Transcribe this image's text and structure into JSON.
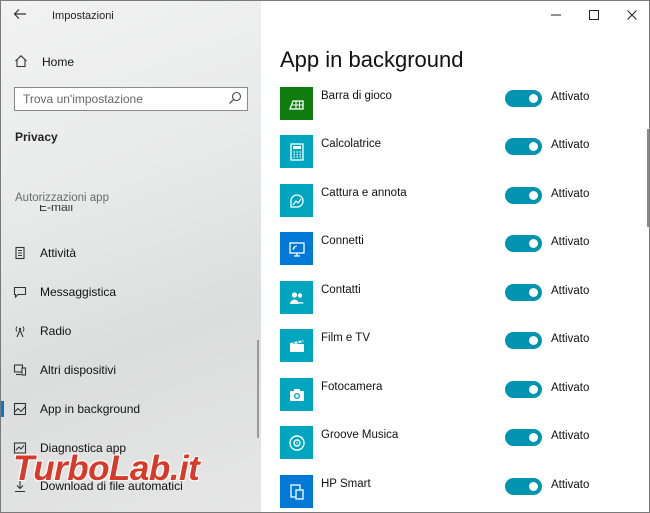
{
  "window": {
    "title": "Impostazioni"
  },
  "sidebar": {
    "home_label": "Home",
    "search_placeholder": "Trova un'impostazione",
    "section_title": "Privacy",
    "group_label": "Autorizzazioni app",
    "partial_item": "E-mail",
    "items": [
      {
        "label": "Attività",
        "icon": "activity-icon"
      },
      {
        "label": "Messaggistica",
        "icon": "message-icon"
      },
      {
        "label": "Radio",
        "icon": "radio-icon"
      },
      {
        "label": "Altri dispositivi",
        "icon": "devices-icon"
      },
      {
        "label": "App in background",
        "icon": "background-apps-icon",
        "active": true
      },
      {
        "label": "Diagnostica app",
        "icon": "diagnostics-icon"
      },
      {
        "label": "Download di file automatici",
        "icon": "download-icon"
      }
    ]
  },
  "main": {
    "title": "App in background",
    "apps": [
      {
        "name": "Barra di gioco",
        "state": "Attivato",
        "tile_color": "#107c10",
        "icon": "game-bar-icon"
      },
      {
        "name": "Calcolatrice",
        "state": "Attivato",
        "tile_color": "#00a5bf",
        "icon": "calculator-icon"
      },
      {
        "name": "Cattura e annota",
        "state": "Attivato",
        "tile_color": "#00a5bf",
        "icon": "snip-icon"
      },
      {
        "name": "Connetti",
        "state": "Attivato",
        "tile_color": "#0078d7",
        "icon": "connect-icon"
      },
      {
        "name": "Contatti",
        "state": "Attivato",
        "tile_color": "#00a5bf",
        "icon": "contacts-icon"
      },
      {
        "name": "Film e TV",
        "state": "Attivato",
        "tile_color": "#00a5bf",
        "icon": "movies-icon"
      },
      {
        "name": "Fotocamera",
        "state": "Attivato",
        "tile_color": "#00a5bf",
        "icon": "camera-icon"
      },
      {
        "name": "Groove Musica",
        "state": "Attivato",
        "tile_color": "#00a5bf",
        "icon": "groove-icon"
      },
      {
        "name": "HP Smart",
        "state": "Attivato",
        "tile_color": "#0078d7",
        "icon": "hp-smart-icon"
      }
    ]
  },
  "watermark": {
    "text": "TurboLab.it"
  },
  "colors": {
    "accent": "#0078d7",
    "toggle_on": "#0094b0",
    "watermark": "#d83a2a"
  }
}
